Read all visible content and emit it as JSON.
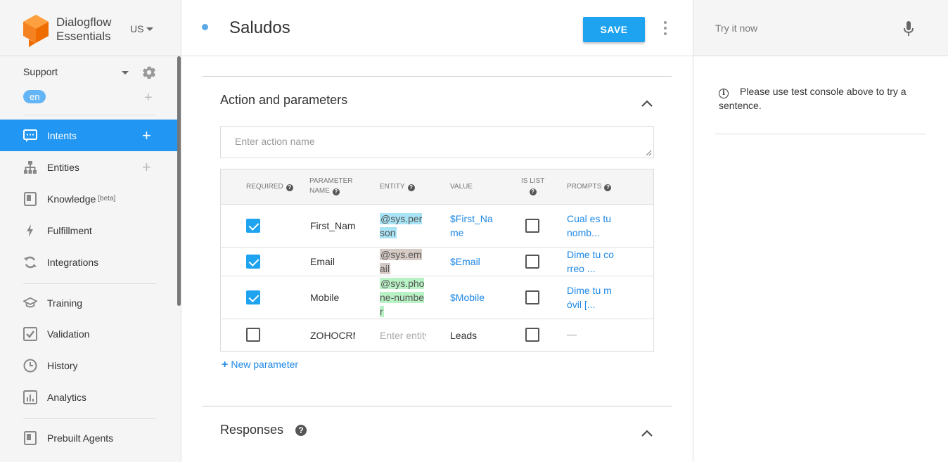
{
  "brand": {
    "line1": "Dialogflow",
    "line2": "Essentials",
    "region": "US"
  },
  "agent": {
    "name": "Support",
    "language": "en"
  },
  "nav": {
    "intents": "Intents",
    "entities": "Entities",
    "knowledge": "Knowledge",
    "knowledge_badge": "[beta]",
    "fulfillment": "Fulfillment",
    "integrations": "Integrations",
    "training": "Training",
    "validation": "Validation",
    "history": "History",
    "analytics": "Analytics",
    "prebuilt": "Prebuilt Agents"
  },
  "header": {
    "title": "Saludos",
    "save_label": "SAVE"
  },
  "action_section": {
    "title": "Action and parameters",
    "action_placeholder": "Enter action name",
    "columns": {
      "required": "REQUIRED",
      "parameter_name_1": "PARAMETER",
      "parameter_name_2": "NAME",
      "entity": "ENTITY",
      "value": "VALUE",
      "is_list": "IS LIST",
      "prompts": "PROMPTS"
    },
    "rows": [
      {
        "required": true,
        "name": "First_Name",
        "entity": "@sys.person",
        "value": "$First_Name",
        "is_list": false,
        "prompts": "Cual es tu nomb..."
      },
      {
        "required": true,
        "name": "Email",
        "entity": "@sys.email",
        "value": "$Email",
        "is_list": false,
        "prompts": "Dime tu correo ..."
      },
      {
        "required": true,
        "name": "Mobile",
        "entity": "@sys.phone-number",
        "value": "$Mobile",
        "is_list": false,
        "prompts": "Dime tu móvil [..."
      },
      {
        "required": false,
        "name": "ZOHOCRM",
        "entity_placeholder": "Enter entity",
        "value": "Leads",
        "is_list": false,
        "prompts": "—"
      }
    ],
    "new_parameter": "New parameter"
  },
  "responses_section": {
    "title": "Responses"
  },
  "test_panel": {
    "placeholder": "Try it now",
    "message": "Please use test console above to try a sentence."
  },
  "colors": {
    "accent": "#1ea3f1",
    "active_nav": "#2196f3",
    "link": "#1e88e5"
  }
}
